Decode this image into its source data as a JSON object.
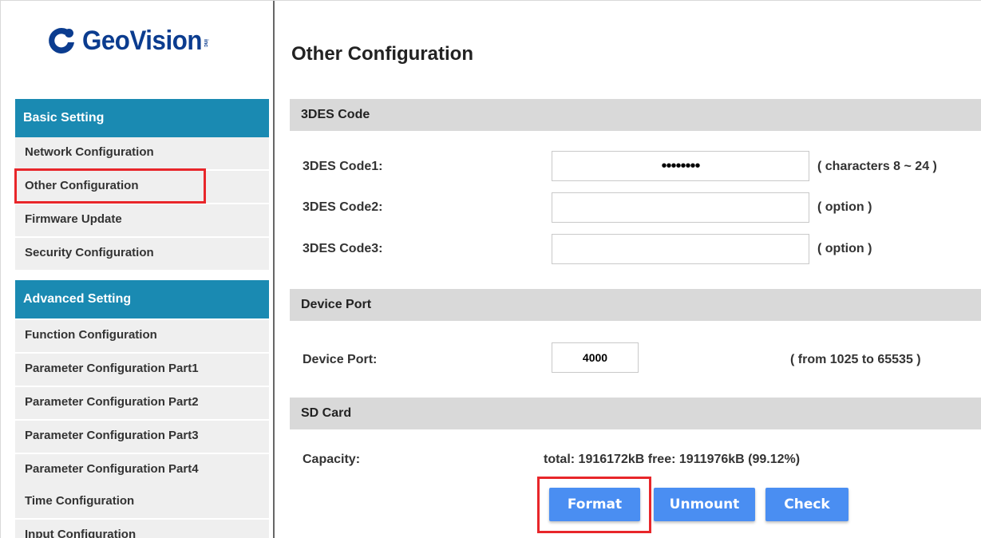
{
  "brand": {
    "name": "GeoVision",
    "suffix": "inc"
  },
  "sidebar": {
    "basic_header": "Basic Setting",
    "basic_items": [
      {
        "label": "Network Configuration"
      },
      {
        "label": "Other Configuration",
        "selected": true
      },
      {
        "label": "Firmware Update"
      },
      {
        "label": "Security Configuration"
      }
    ],
    "advanced_header": "Advanced Setting",
    "advanced_items": [
      {
        "label": "Function Configuration"
      },
      {
        "label": "Parameter Configuration Part1"
      },
      {
        "label": "Parameter Configuration Part2"
      },
      {
        "label": "Parameter Configuration Part3"
      },
      {
        "label": "Parameter Configuration Part4"
      },
      {
        "label": "Time Configuration"
      },
      {
        "label": "Input Configuration"
      }
    ]
  },
  "main": {
    "title": "Other Configuration",
    "des": {
      "section_title": "3DES Code",
      "code1": {
        "label": "3DES Code1:",
        "value": "••••••••",
        "hint": "( characters 8 ~ 24 )"
      },
      "code2": {
        "label": "3DES Code2:",
        "value": "",
        "hint": "( option )"
      },
      "code3": {
        "label": "3DES Code3:",
        "value": "",
        "hint": "( option )"
      }
    },
    "device_port": {
      "section_title": "Device Port",
      "label": "Device Port:",
      "value": "4000",
      "hint": "( from 1025 to 65535 )"
    },
    "sd_card": {
      "section_title": "SD Card",
      "capacity_label": "Capacity:",
      "capacity_value": "total: 1916172kB free: 1911976kB (99.12%)",
      "format_label": "Format",
      "unmount_label": "Unmount",
      "check_label": "Check"
    }
  },
  "colors": {
    "sidebar_header": "#1a8ab2",
    "sidebar_item": "#efefef",
    "section_bar": "#d9d9d9",
    "button": "#4a8ef2",
    "highlight": "#e8262a",
    "brand": "#0b3c8f"
  }
}
